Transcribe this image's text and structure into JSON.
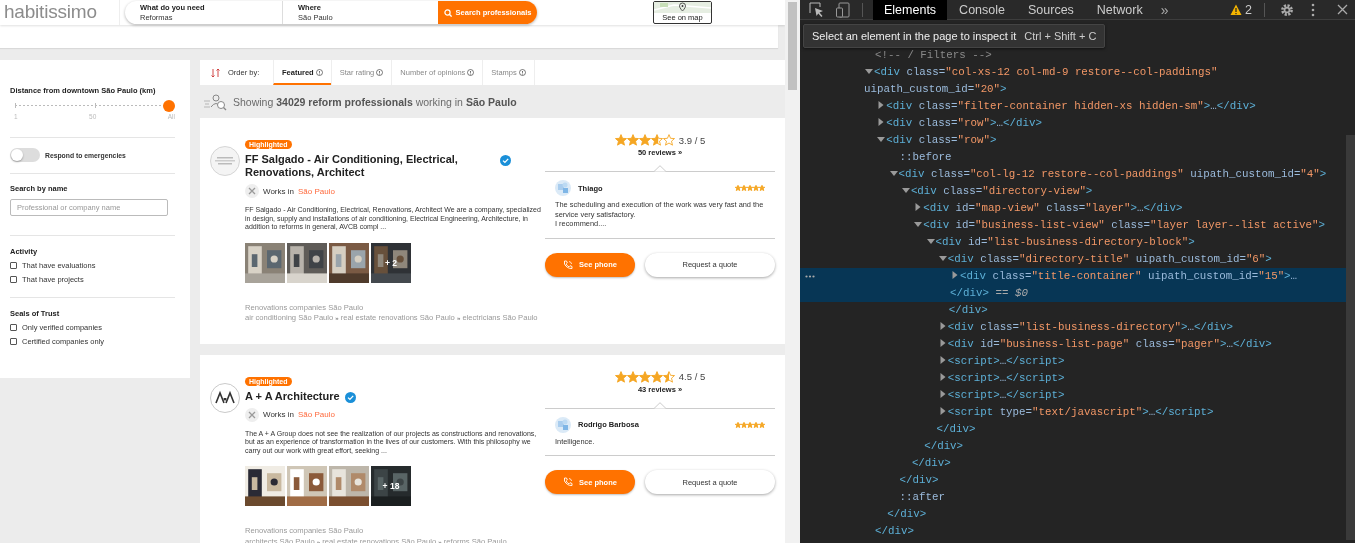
{
  "page": {
    "header": {
      "logo": "habitissimo",
      "fields": [
        {
          "label": "What do you need",
          "value": "Reformas"
        },
        {
          "label": "Where",
          "value": "São Paulo"
        }
      ],
      "search_button": "Search professionals",
      "map_button": "See on map"
    },
    "filters": {
      "distance": {
        "title": "Distance from downtown São Paulo (km)",
        "level": 1,
        "ticks": [
          "1",
          "50",
          "All"
        ]
      },
      "emergencies": {
        "label": "Respond to emergencies",
        "on": false
      },
      "search_by_name": {
        "title": "Search by name",
        "placeholder": "Professional or company name"
      },
      "groups": [
        {
          "title": "Activity",
          "options": [
            {
              "label": "That have evaluations",
              "checked": false
            },
            {
              "label": "That have projects",
              "checked": false
            }
          ]
        },
        {
          "title": "Seals of Trust",
          "options": [
            {
              "label": "Only verified companies",
              "checked": false
            },
            {
              "label": "Certified companies only",
              "checked": false
            }
          ]
        }
      ]
    },
    "sort": {
      "label": "Order by:",
      "tabs": [
        {
          "label": "Featured",
          "selected": true
        },
        {
          "label": "Star rating",
          "selected": false
        },
        {
          "label": "Number of opinions",
          "selected": false
        },
        {
          "label": "Stamps",
          "selected": false
        }
      ]
    },
    "summary": "Showing **34029 reform professionals** working in **São Paulo**",
    "listings": [
      {
        "logo": {
          "kind": "picture"
        },
        "badge": "Highlighted",
        "name": "FF Salgado - Air Conditioning, Electrical, Renovations, Architect",
        "verified": true,
        "works_in": "Works in",
        "city": "São Paulo",
        "description": "FF Salgado - Air Conditioning, Electrical, Renovations, Architect We are a company, specialized in design, supply and installations of air conditioning, Electrical Engineering, Architecture, in addition to reforms in general, AVCB compl ...",
        "photos": [
          {
            "kind": "picture"
          },
          {
            "kind": "picture"
          },
          {
            "kind": "picture"
          },
          {
            "kind": "picture",
            "more": "+ 2"
          }
        ],
        "categories_title": "Renovations companies São Paulo",
        "categories": [
          "air conditioning São Paulo",
          "real estate renovations São Paulo",
          "electricians São Paulo"
        ],
        "separator": "»",
        "stars": 3.6,
        "rating": "3.9 / 5",
        "reviews": "50 reviews »",
        "review": {
          "author": "Thiago",
          "stars": 5,
          "text": "The scheduling and execution of the work was very fast and the service very satisfactory.\nI recommend...."
        },
        "phone_button": "See phone",
        "quote_button": "Request a quote"
      },
      {
        "logo": {
          "kind": "picture"
        },
        "badge": "Highlighted",
        "name": "A + A Architecture",
        "verified": true,
        "works_in": "Works in",
        "city": "São Paulo",
        "description": "The A + A Group does not see the realization of our projects as constructions and renovations, but as an experience of transformation in the lives of our customers. With this philosophy we carry out our work with great effort, seeking ...",
        "photos": [
          {
            "kind": "picture"
          },
          {
            "kind": "picture"
          },
          {
            "kind": "picture"
          },
          {
            "kind": "picture",
            "more": "+ 18"
          }
        ],
        "categories_title": "Renovations companies São Paulo",
        "categories": [
          "architects São Paulo",
          "real estate renovations São Paulo",
          "reforms São Paulo"
        ],
        "separator": "»",
        "stars": 4.5,
        "rating": "4.5 / 5",
        "reviews": "43 reviews »",
        "review": {
          "author": "Rodrigo Barbosa",
          "stars": 5,
          "text": "Intelligence."
        },
        "phone_button": "See phone",
        "quote_button": "Request a quote"
      }
    ]
  },
  "devtools": {
    "tabs": [
      {
        "label": "Elements",
        "selected": true
      },
      {
        "label": "Console",
        "selected": false
      },
      {
        "label": "Sources",
        "selected": false
      },
      {
        "label": "Network",
        "selected": false
      }
    ],
    "more_tabs": "»",
    "warnings": "2",
    "tooltip": {
      "text": "Select an element in the page to inspect it",
      "shortcut": "Ctrl + Shift + C"
    },
    "dom": [
      {
        "kind": "comment",
        "markup": "<!-- / Filters -->",
        "selected": false
      },
      {
        "kind": "element",
        "markup": [
          "<div class=\"col-xs-12 col-md-9 restore--col-paddings\"",
          "uipath_custom_id=\"20\">"
        ],
        "expanded": true,
        "selected": false,
        "close": "</div>",
        "children": [
          {
            "kind": "element",
            "markup": "<div class=\"filter-container hidden-xs hidden-sm\">…</div>",
            "expanded": false,
            "selected": false
          },
          {
            "kind": "element",
            "markup": "<div class=\"row\">…</div>",
            "expanded": false,
            "selected": false
          },
          {
            "kind": "element",
            "markup": "<div class=\"row\">",
            "expanded": true,
            "selected": false,
            "close": "</div>",
            "children": [
              {
                "kind": "pseudo",
                "markup": "::before",
                "selected": false
              },
              {
                "kind": "element",
                "markup": "<div class=\"col-lg-12 restore--col-paddings\" uipath_custom_id=\"4\">",
                "expanded": true,
                "selected": false,
                "close": "</div>",
                "children": [
                  {
                    "kind": "element",
                    "markup": "<div class=\"directory-view\">",
                    "expanded": true,
                    "selected": false,
                    "close": "</div>",
                    "children": [
                      {
                        "kind": "element",
                        "markup": "<div id=\"map-view\" class=\"layer\">…</div>",
                        "expanded": false,
                        "selected": false
                      },
                      {
                        "kind": "element",
                        "markup": "<div id=\"business-list-view\" class=\"layer layer--list active\">",
                        "expanded": true,
                        "selected": false,
                        "close": "</div>",
                        "children": [
                          {
                            "kind": "element",
                            "markup": "<div id=\"list-business-directory-block\">",
                            "expanded": true,
                            "selected": false,
                            "close": "</div>",
                            "children": [
                              {
                                "kind": "element",
                                "markup": "<div class=\"directory-title\" uipath_custom_id=\"6\">",
                                "expanded": true,
                                "selected": false,
                                "close": "</div>",
                                "children": [
                                  {
                                    "kind": "element",
                                    "markup": [
                                      "<div class=\"title-container\" uipath_custom_id=\"15\">…",
                                      "</div>"
                                    ],
                                    "console_ref": "== $0",
                                    "expanded": false,
                                    "selected": true
                                  }
                                ]
                              },
                              {
                                "kind": "element",
                                "markup": "<div class=\"list-business-directory\">…</div>",
                                "expanded": false,
                                "selected": false
                              },
                              {
                                "kind": "element",
                                "markup": "<div id=\"business-list-page\" class=\"pager\">…</div>",
                                "expanded": false,
                                "selected": false
                              },
                              {
                                "kind": "element",
                                "markup": "<script>…</script>",
                                "expanded": false,
                                "selected": false
                              },
                              {
                                "kind": "element",
                                "markup": "<script>…</script>",
                                "expanded": false,
                                "selected": false
                              },
                              {
                                "kind": "element",
                                "markup": "<script>…</script>",
                                "expanded": false,
                                "selected": false
                              },
                              {
                                "kind": "element",
                                "markup": "<script type=\"text/javascript\">…</script>",
                                "expanded": false,
                                "selected": false
                              }
                            ]
                          }
                        ]
                      }
                    ]
                  }
                ]
              },
              {
                "kind": "pseudo",
                "markup": "::after",
                "selected": false
              }
            ]
          }
        ]
      }
    ]
  }
}
